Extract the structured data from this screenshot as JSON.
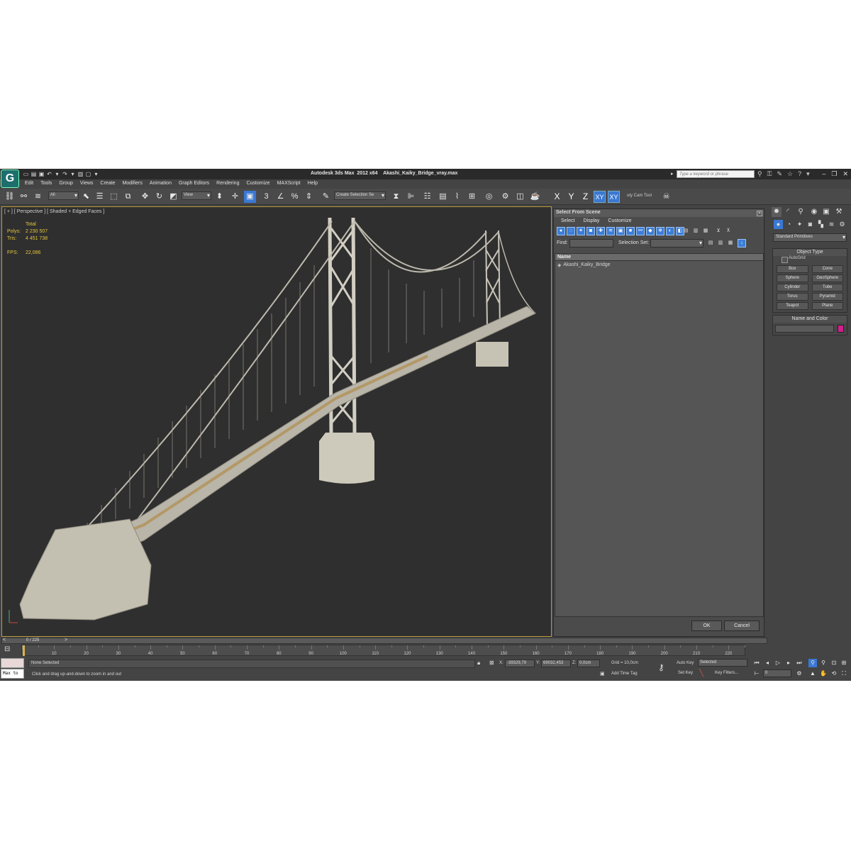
{
  "titlebar": {
    "app_name": "Autodesk 3ds Max  2012 x64",
    "file_name": "Akashi_Kaiky_Bridge_vray.max",
    "search_placeholder": "Type a keyword or phrase"
  },
  "menu": [
    "Edit",
    "Tools",
    "Group",
    "Views",
    "Create",
    "Modifiers",
    "Animation",
    "Graph Editors",
    "Rendering",
    "Customize",
    "MAXScript",
    "Help"
  ],
  "toolbar": {
    "selection_filter": "All",
    "reference_coord": "View",
    "selection_set": "Create Selection Se",
    "axes": [
      "X",
      "Y",
      "Z",
      "XY",
      "XY"
    ],
    "utility_label": "uty Cam Tool"
  },
  "viewport": {
    "label": "[ + ] [ Perspective ] [ Shaded + Edged Faces ]",
    "stats": {
      "total_label": "Total",
      "polys_label": "Polys:",
      "polys_value": "2 230 507",
      "tris_label": "Tris:",
      "tris_value": "4 451 738",
      "fps_label": "FPS:",
      "fps_value": "22,086"
    }
  },
  "select_dialog": {
    "title": "Select From Scene",
    "menu": [
      "Select",
      "Display",
      "Customize"
    ],
    "find_label": "Find:",
    "selection_set_label": "Selection Set:",
    "column_name": "Name",
    "items": [
      "Akashi_Kaiky_Bridge"
    ],
    "ok_label": "OK",
    "cancel_label": "Cancel"
  },
  "command_panel": {
    "category": "Standard Primitives",
    "object_type_title": "Object Type",
    "autogrid_label": "AutoGrid",
    "primitives": [
      "Box",
      "Cone",
      "Sphere",
      "GeoSphere",
      "Cylinder",
      "Tube",
      "Torus",
      "Pyramid",
      "Teapot",
      "Plane"
    ],
    "name_color_title": "Name and Color",
    "object_color": "#d21f8c"
  },
  "timeline": {
    "frame_display": "0 / 225",
    "ticks": [
      "10",
      "20",
      "30",
      "40",
      "50",
      "60",
      "70",
      "80",
      "90",
      "100",
      "110",
      "120",
      "130",
      "140",
      "150",
      "160",
      "170",
      "180",
      "190",
      "200",
      "210",
      "220"
    ]
  },
  "status": {
    "maxscript_text": "Max to",
    "selection": "None Selected",
    "prompt": "Click and drag up-and-down to zoom in and out",
    "x_label": "X:",
    "x_value": "-39329,79",
    "y_label": "Y:",
    "y_value": "69032,453",
    "z_label": "Z:",
    "z_value": "0,0cm",
    "grid": "Grid = 10,0cm",
    "add_time_tag": "Add Time Tag",
    "auto_key": "Auto Key",
    "set_key": "Set Key",
    "key_mode": "Selected",
    "key_filters": "Key Filters...",
    "current_frame": "0"
  }
}
